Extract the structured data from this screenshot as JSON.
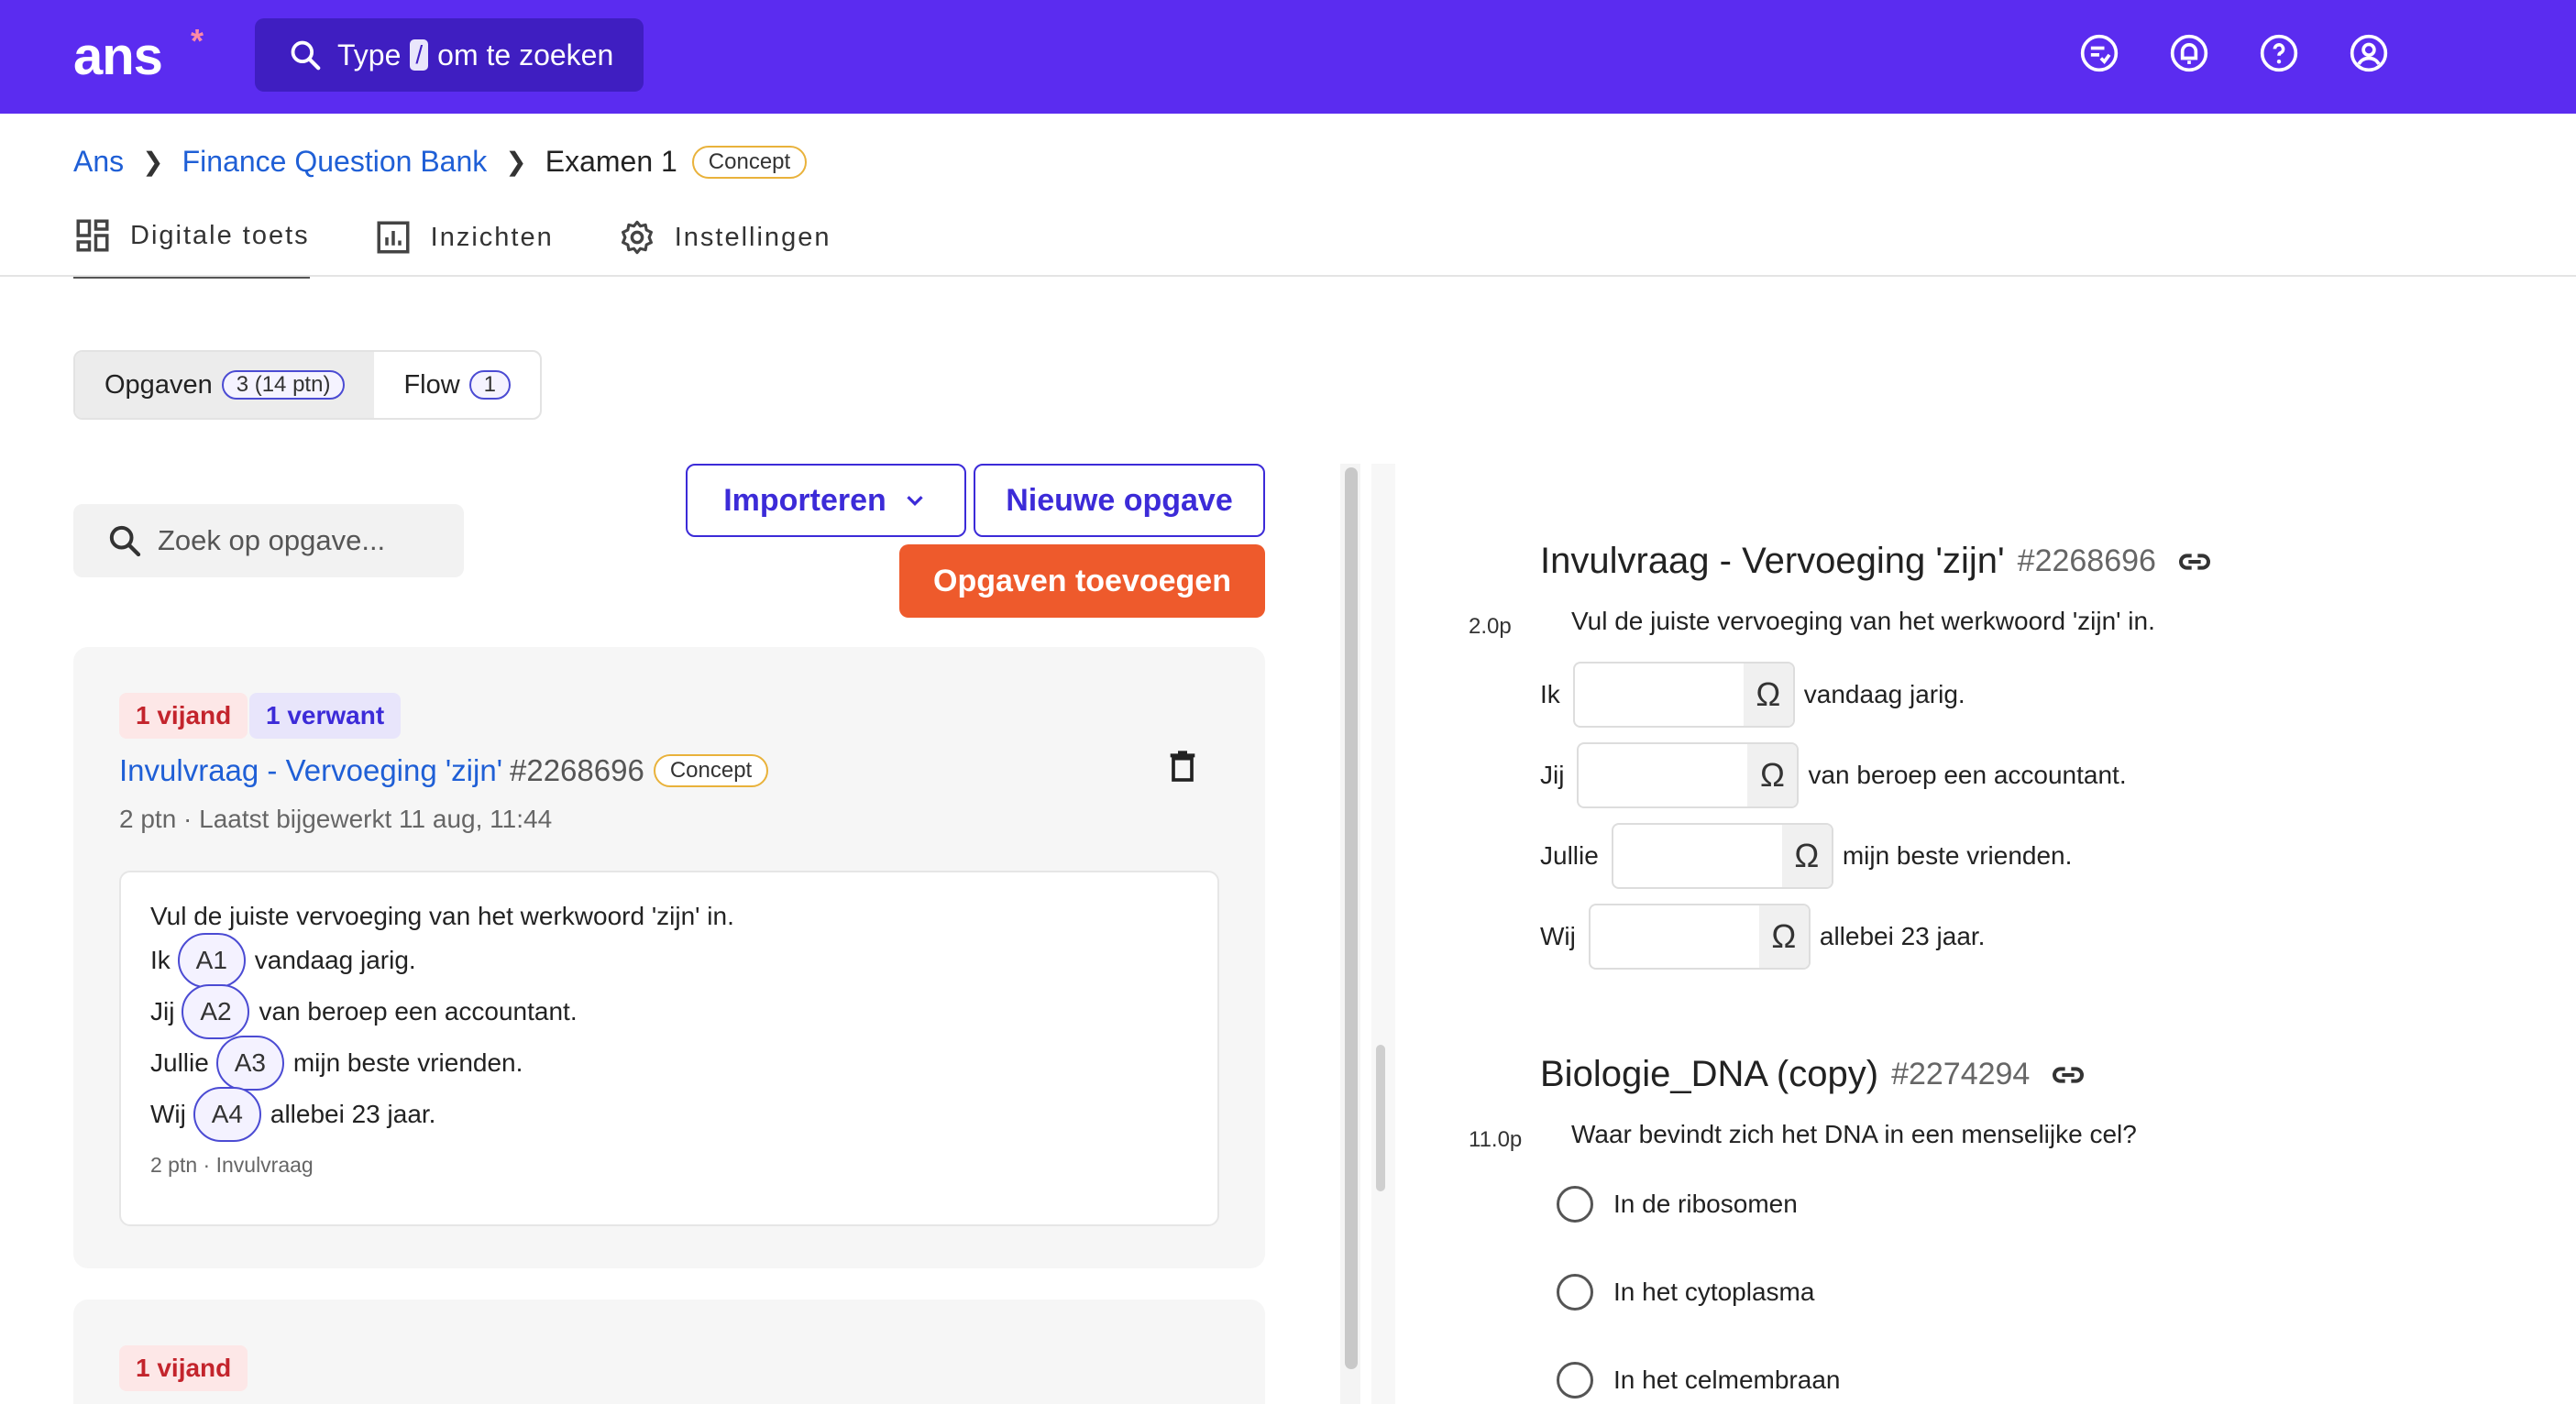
{
  "app": {
    "logo": "ans",
    "logo_star": "*"
  },
  "topbar": {
    "search_prefix": "Type",
    "search_key": "/",
    "search_suffix": "om te zoeken",
    "icons": [
      "task-list-icon",
      "bell-icon",
      "help-icon",
      "user-icon"
    ]
  },
  "breadcrumb": {
    "root": "Ans",
    "bank": "Finance Question Bank",
    "current": "Examen 1",
    "status": "Concept"
  },
  "tabs": [
    {
      "label": "Digitale toets",
      "icon": "dashboard-icon"
    },
    {
      "label": "Inzichten",
      "icon": "chart-icon"
    },
    {
      "label": "Instellingen",
      "icon": "gear-icon"
    }
  ],
  "segment": {
    "opgaven_label": "Opgaven",
    "opgaven_count": "3 (14 ptn)",
    "flow_label": "Flow",
    "flow_count": "1"
  },
  "left": {
    "search_placeholder": "Zoek op opgave...",
    "import_label": "Importeren",
    "new_label": "Nieuwe opgave",
    "add_label": "Opgaven toevoegen"
  },
  "cards": [
    {
      "tag_enemy": "1 vijand",
      "tag_related": "1 verwant",
      "title": "Invulvraag - Vervoeging 'zijn'",
      "id": "#2268696",
      "status": "Concept",
      "meta": "2 ptn · Laatst bijgewerkt 11 aug, 11:44",
      "prompt": "Vul de juiste vervoeging van het werkwoord 'zijn' in.",
      "lines": [
        {
          "pre": "Ik",
          "chip": "A1",
          "post": "vandaag jarig."
        },
        {
          "pre": "Jij",
          "chip": "A2",
          "post": "van beroep een accountant."
        },
        {
          "pre": "Jullie",
          "chip": "A3",
          "post": "mijn beste vrienden."
        },
        {
          "pre": "Wij",
          "chip": "A4",
          "post": "allebei 23 jaar."
        }
      ],
      "sub": "2 ptn · Invulvraag"
    },
    {
      "tag_enemy": "1 vijand"
    }
  ],
  "preview": {
    "q1": {
      "title": "Invulvraag - Vervoeging 'zijn'",
      "id": "#2268696",
      "points": "2.0p",
      "text": "Vul de juiste vervoeging van het werkwoord 'zijn' in.",
      "rows": [
        {
          "pre": "Ik",
          "post": "vandaag jarig."
        },
        {
          "pre": "Jij",
          "post": "van beroep een accountant."
        },
        {
          "pre": "Jullie",
          "post": "mijn beste vrienden."
        },
        {
          "pre": "Wij",
          "post": "allebei 23 jaar."
        }
      ],
      "omega": "Ω"
    },
    "q2": {
      "title": "Biologie_DNA (copy)",
      "id": "#2274294",
      "points": "11.0p",
      "text": "Waar bevindt zich het DNA in een menselijke cel?",
      "options": [
        "In de ribosomen",
        "In het cytoplasma",
        "In het celmembraan"
      ]
    }
  }
}
